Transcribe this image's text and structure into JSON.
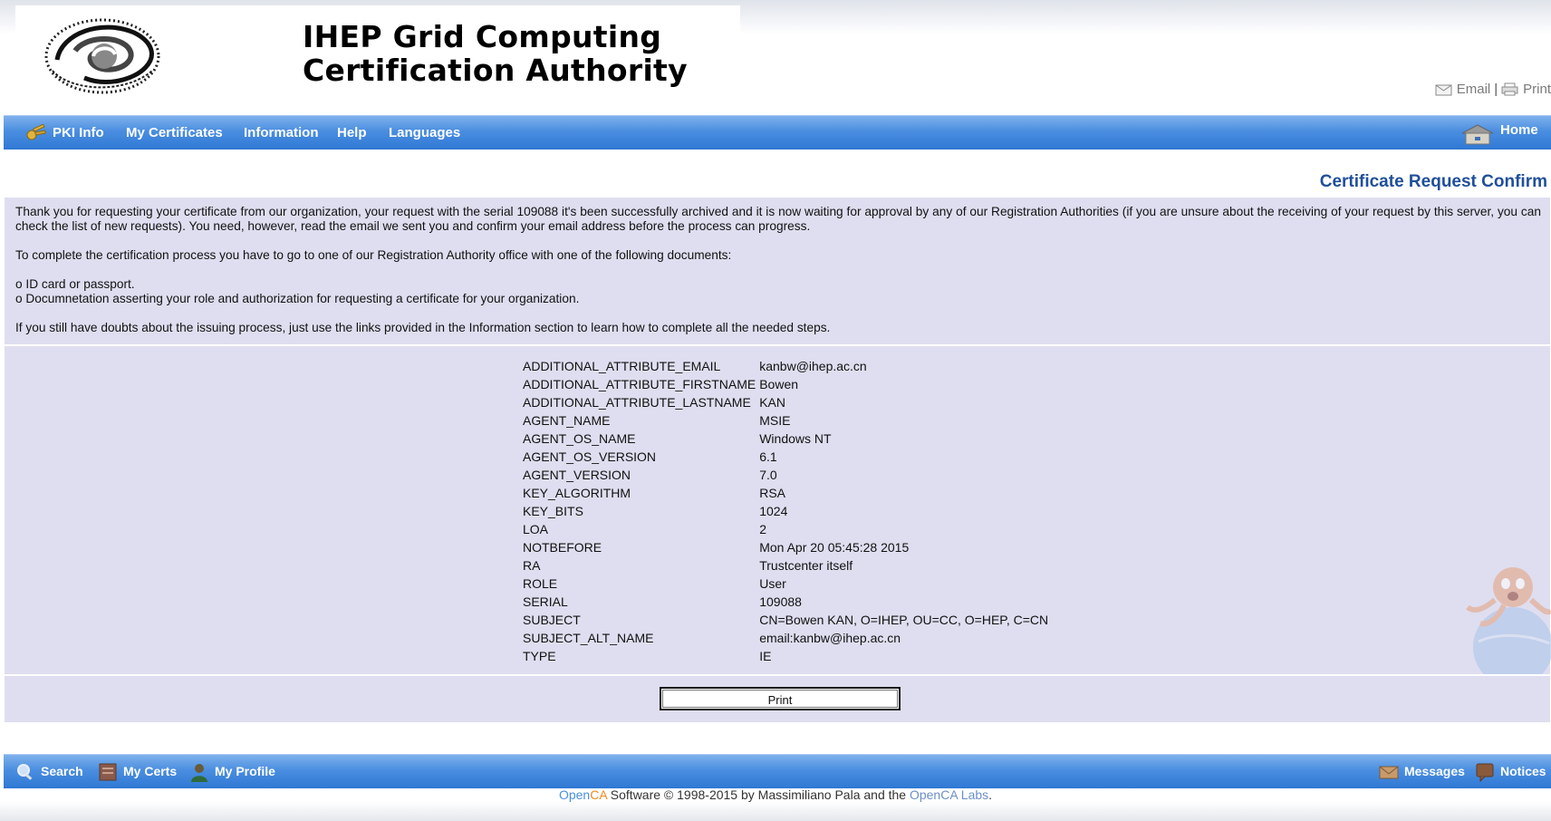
{
  "header": {
    "title_line1": "IHEP Grid Computing",
    "title_line2": "Certification Authority",
    "email_link": "Email",
    "separator": "|",
    "print_link": "Print"
  },
  "topnav": {
    "pki_info": "PKI Info",
    "my_certificates": "My Certificates",
    "information": "Information",
    "help": "Help",
    "languages": "Languages",
    "home": "Home"
  },
  "main": {
    "page_title": "Certificate Request Confirm",
    "intro_p1": "Thank you for requesting your certificate from our organization, your request with the serial 109088 it's been successfully archived and it is now waiting for approval by any of our Registration Authorities (if you are unsure about the receiving of your request by this server, you can check the list of new requests). You need, however, read the email we sent you and confirm your email address before the process can progress.",
    "intro_p2": "To complete the certification process you have to go to one of our Registration Authority office with one of the following documents:",
    "doc_item1": "o ID card or passport.",
    "doc_item2": "o Documnetation asserting your role and authorization for requesting a certificate for your organization.",
    "intro_p3": "If you still have doubts about the issuing process, just use the links provided in the Information section to learn how to complete all the needed steps.",
    "print_button": "Print"
  },
  "attributes": [
    {
      "key": "ADDITIONAL_ATTRIBUTE_EMAIL",
      "value": "kanbw@ihep.ac.cn"
    },
    {
      "key": "ADDITIONAL_ATTRIBUTE_FIRSTNAME",
      "value": "Bowen"
    },
    {
      "key": "ADDITIONAL_ATTRIBUTE_LASTNAME",
      "value": "KAN"
    },
    {
      "key": "AGENT_NAME",
      "value": "MSIE"
    },
    {
      "key": "AGENT_OS_NAME",
      "value": "Windows NT"
    },
    {
      "key": "AGENT_OS_VERSION",
      "value": "6.1"
    },
    {
      "key": "AGENT_VERSION",
      "value": "7.0"
    },
    {
      "key": "KEY_ALGORITHM",
      "value": "RSA"
    },
    {
      "key": "KEY_BITS",
      "value": "1024"
    },
    {
      "key": "LOA",
      "value": "2"
    },
    {
      "key": "NOTBEFORE",
      "value": "Mon Apr 20 05:45:28 2015"
    },
    {
      "key": "RA",
      "value": "Trustcenter itself"
    },
    {
      "key": "ROLE",
      "value": "User"
    },
    {
      "key": "SERIAL",
      "value": "109088"
    },
    {
      "key": "SUBJECT",
      "value": "CN=Bowen KAN, O=IHEP, OU=CC, O=HEP, C=CN"
    },
    {
      "key": "SUBJECT_ALT_NAME",
      "value": "email:kanbw@ihep.ac.cn"
    },
    {
      "key": "TYPE",
      "value": "IE"
    }
  ],
  "bottomnav": {
    "search": "Search",
    "my_certs": "My Certs",
    "my_profile": "My Profile",
    "messages": "Messages",
    "notices": "Notices"
  },
  "footer": {
    "open": "Open",
    "ca": "CA",
    "text1": " Software © 1998-2015 by Massimiliano Pala and the ",
    "labs": "OpenCA Labs",
    "text2": "."
  },
  "colors": {
    "nav_blue": "#3f86dc",
    "panel_bg": "#dedef0",
    "title_blue": "#1f4f9a",
    "open_blue": "#4a8ee0",
    "ca_orange": "#f08a1c"
  },
  "icons": [
    "logo-swirl",
    "email-icon",
    "print-icon",
    "pki-key-icon",
    "home-icon",
    "search-icon",
    "my-certs-icon",
    "my-profile-icon",
    "messages-icon",
    "notices-icon",
    "octopus-mascot"
  ]
}
